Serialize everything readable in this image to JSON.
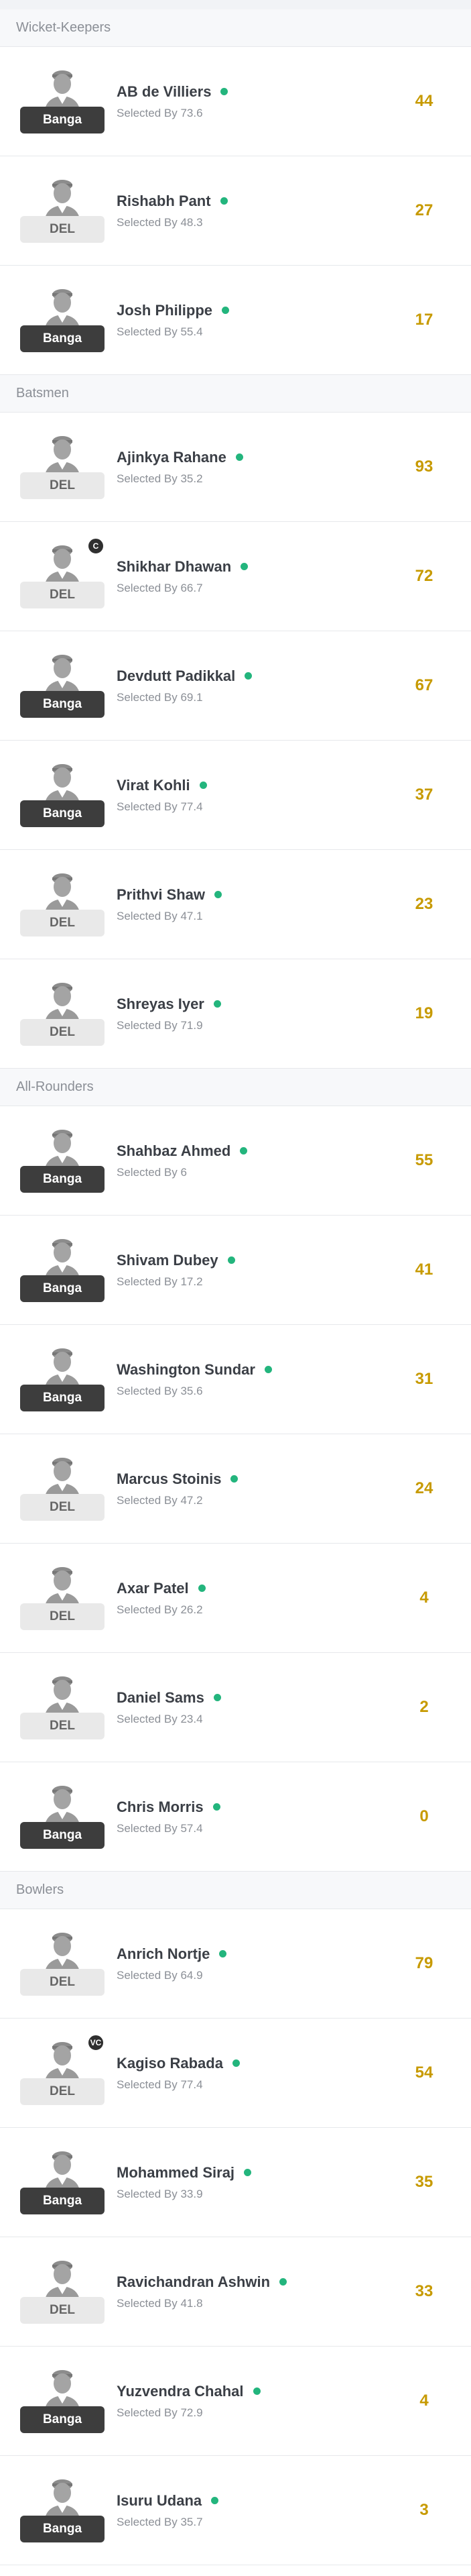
{
  "sections": [
    {
      "title": "Wicket-Keepers",
      "players": [
        {
          "name": "AB de Villiers",
          "team": "Banga",
          "team_style": "dark",
          "selected_prefix": "Selected By",
          "selected": "73.6",
          "points": "44",
          "role": ""
        },
        {
          "name": "Rishabh Pant",
          "team": "DEL",
          "team_style": "light",
          "selected_prefix": "Selected By",
          "selected": "48.3",
          "points": "27",
          "role": ""
        },
        {
          "name": "Josh Philippe",
          "team": "Banga",
          "team_style": "dark",
          "selected_prefix": "Selected By",
          "selected": "55.4",
          "points": "17",
          "role": ""
        }
      ]
    },
    {
      "title": "Batsmen",
      "players": [
        {
          "name": "Ajinkya Rahane",
          "team": "DEL",
          "team_style": "light",
          "selected_prefix": "Selected By",
          "selected": "35.2",
          "points": "93",
          "role": ""
        },
        {
          "name": "Shikhar Dhawan",
          "team": "DEL",
          "team_style": "light",
          "selected_prefix": "Selected By",
          "selected": "66.7",
          "points": "72",
          "role": "C"
        },
        {
          "name": "Devdutt Padikkal",
          "team": "Banga",
          "team_style": "dark",
          "selected_prefix": "Selected By",
          "selected": "69.1",
          "points": "67",
          "role": ""
        },
        {
          "name": "Virat Kohli",
          "team": "Banga",
          "team_style": "dark",
          "selected_prefix": "Selected By",
          "selected": "77.4",
          "points": "37",
          "role": ""
        },
        {
          "name": "Prithvi Shaw",
          "team": "DEL",
          "team_style": "light",
          "selected_prefix": "Selected By",
          "selected": "47.1",
          "points": "23",
          "role": ""
        },
        {
          "name": "Shreyas Iyer",
          "team": "DEL",
          "team_style": "light",
          "selected_prefix": "Selected By",
          "selected": "71.9",
          "points": "19",
          "role": ""
        }
      ]
    },
    {
      "title": "All-Rounders",
      "players": [
        {
          "name": "Shahbaz Ahmed",
          "team": "Banga",
          "team_style": "dark",
          "selected_prefix": "Selected By",
          "selected": "6",
          "points": "55",
          "role": ""
        },
        {
          "name": "Shivam Dubey",
          "team": "Banga",
          "team_style": "dark",
          "selected_prefix": "Selected By",
          "selected": "17.2",
          "points": "41",
          "role": ""
        },
        {
          "name": "Washington Sundar",
          "team": "Banga",
          "team_style": "dark",
          "selected_prefix": "Selected By",
          "selected": "35.6",
          "points": "31",
          "role": ""
        },
        {
          "name": "Marcus Stoinis",
          "team": "DEL",
          "team_style": "light",
          "selected_prefix": "Selected By",
          "selected": "47.2",
          "points": "24",
          "role": ""
        },
        {
          "name": "Axar Patel",
          "team": "DEL",
          "team_style": "light",
          "selected_prefix": "Selected By",
          "selected": "26.2",
          "points": "4",
          "role": ""
        },
        {
          "name": "Daniel Sams",
          "team": "DEL",
          "team_style": "light",
          "selected_prefix": "Selected By",
          "selected": "23.4",
          "points": "2",
          "role": ""
        },
        {
          "name": "Chris Morris",
          "team": "Banga",
          "team_style": "dark",
          "selected_prefix": "Selected By",
          "selected": "57.4",
          "points": "0",
          "role": ""
        }
      ]
    },
    {
      "title": "Bowlers",
      "players": [
        {
          "name": "Anrich Nortje",
          "team": "DEL",
          "team_style": "light",
          "selected_prefix": "Selected By",
          "selected": "64.9",
          "points": "79",
          "role": ""
        },
        {
          "name": "Kagiso Rabada",
          "team": "DEL",
          "team_style": "light",
          "selected_prefix": "Selected By",
          "selected": "77.4",
          "points": "54",
          "role": "VC"
        },
        {
          "name": "Mohammed Siraj",
          "team": "Banga",
          "team_style": "dark",
          "selected_prefix": "Selected By",
          "selected": "33.9",
          "points": "35",
          "role": ""
        },
        {
          "name": "Ravichandran Ashwin",
          "team": "DEL",
          "team_style": "light",
          "selected_prefix": "Selected By",
          "selected": "41.8",
          "points": "33",
          "role": ""
        },
        {
          "name": "Yuzvendra Chahal",
          "team": "Banga",
          "team_style": "dark",
          "selected_prefix": "Selected By",
          "selected": "72.9",
          "points": "4",
          "role": ""
        },
        {
          "name": "Isuru Udana",
          "team": "Banga",
          "team_style": "dark",
          "selected_prefix": "Selected By",
          "selected": "35.7",
          "points": "3",
          "role": ""
        }
      ]
    }
  ],
  "colors": {
    "points": "#c79a00",
    "status_dot": "#23b57d",
    "badge_dark": "#3d3d3d",
    "badge_light": "#e9e9e9"
  },
  "icons": {
    "avatar": "player-avatar-icon",
    "status": "playing-status-dot"
  }
}
